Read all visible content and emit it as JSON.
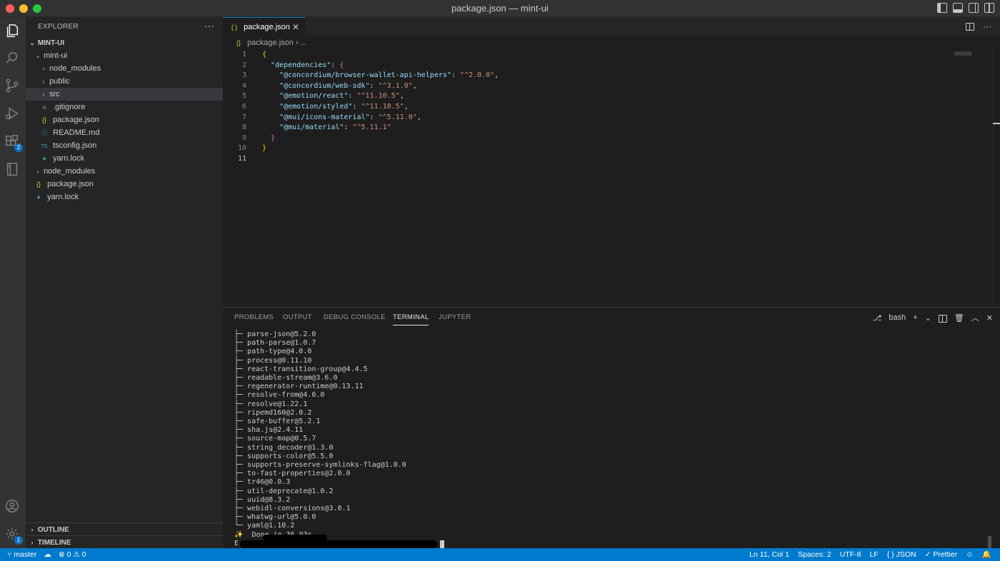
{
  "window": {
    "title": "package.json — mint-ui",
    "layout_icons": [
      "toggle-primary-sidebar-icon",
      "toggle-panel-icon",
      "toggle-secondary-sidebar-icon",
      "customize-layout-icon"
    ]
  },
  "activity_bar": {
    "items": [
      {
        "name": "explorer-icon",
        "active": true
      },
      {
        "name": "search-icon"
      },
      {
        "name": "source-control-icon"
      },
      {
        "name": "run-debug-icon"
      },
      {
        "name": "extensions-icon",
        "badge": "2"
      },
      {
        "name": "notebook-icon"
      }
    ],
    "accounts": "accounts-icon",
    "manage_badge": "1"
  },
  "sidebar": {
    "header": "EXPLORER",
    "more": "···",
    "root": "MINT-UI",
    "tree": [
      {
        "label": "mint-ui",
        "kind": "folder-open",
        "depth": 1
      },
      {
        "label": "node_modules",
        "kind": "folder",
        "depth": 2
      },
      {
        "label": "public",
        "kind": "folder",
        "depth": 2
      },
      {
        "label": "src",
        "kind": "folder",
        "depth": 2,
        "selected": true
      },
      {
        "label": ".gitignore",
        "kind": "git",
        "depth": 2
      },
      {
        "label": "package.json",
        "kind": "json",
        "depth": 2
      },
      {
        "label": "README.md",
        "kind": "info",
        "depth": 2
      },
      {
        "label": "tsconfig.json",
        "kind": "ts",
        "depth": 2
      },
      {
        "label": "yarn.lock",
        "kind": "yarn",
        "depth": 2
      },
      {
        "label": "node_modules",
        "kind": "folder",
        "depth": 1
      },
      {
        "label": "package.json",
        "kind": "json",
        "depth": 1
      },
      {
        "label": "yarn.lock",
        "kind": "yarn",
        "depth": 1
      }
    ],
    "outline": "OUTLINE",
    "timeline": "TIMELINE"
  },
  "tabs": [
    {
      "label": "package.json",
      "icon": "{ }",
      "active": true
    }
  ],
  "breadcrumb": {
    "file": "package.json",
    "rest": "..."
  },
  "editor": {
    "current_line": 11,
    "lines": [
      {
        "n": "1",
        "parts": [
          [
            "b1",
            "{"
          ]
        ]
      },
      {
        "n": "2",
        "parts": [
          [
            "",
            "  "
          ],
          [
            "k",
            "\"dependencies\""
          ],
          [
            "",
            ": "
          ],
          [
            "b2",
            "{"
          ]
        ]
      },
      {
        "n": "3",
        "parts": [
          [
            "",
            "    "
          ],
          [
            "k",
            "\"@concordium/browser-wallet-api-helpers\""
          ],
          [
            "",
            ": "
          ],
          [
            "s",
            "\"^2.0.0\""
          ],
          [
            "",
            ","
          ]
        ]
      },
      {
        "n": "4",
        "parts": [
          [
            "",
            "    "
          ],
          [
            "k",
            "\"@concordium/web-sdk\""
          ],
          [
            "",
            ": "
          ],
          [
            "s",
            "\"^3.1.0\""
          ],
          [
            "",
            ","
          ]
        ]
      },
      {
        "n": "5",
        "parts": [
          [
            "",
            "    "
          ],
          [
            "k",
            "\"@emotion/react\""
          ],
          [
            "",
            ": "
          ],
          [
            "s",
            "\"^11.10.5\""
          ],
          [
            "",
            ","
          ]
        ]
      },
      {
        "n": "6",
        "parts": [
          [
            "",
            "    "
          ],
          [
            "k",
            "\"@emotion/styled\""
          ],
          [
            "",
            ": "
          ],
          [
            "s",
            "\"^11.10.5\""
          ],
          [
            "",
            ","
          ]
        ]
      },
      {
        "n": "7",
        "parts": [
          [
            "",
            "    "
          ],
          [
            "k",
            "\"@mui/icons-material\""
          ],
          [
            "",
            ": "
          ],
          [
            "s",
            "\"^5.11.0\""
          ],
          [
            "",
            ","
          ]
        ]
      },
      {
        "n": "8",
        "parts": [
          [
            "",
            "    "
          ],
          [
            "k",
            "\"@mui/material\""
          ],
          [
            "",
            ": "
          ],
          [
            "s",
            "\"^5.11.1\""
          ]
        ]
      },
      {
        "n": "9",
        "parts": [
          [
            "",
            "  "
          ],
          [
            "b2",
            "}"
          ]
        ]
      },
      {
        "n": "10",
        "parts": [
          [
            "b1",
            "}"
          ]
        ]
      },
      {
        "n": "11",
        "parts": []
      }
    ]
  },
  "panel": {
    "tabs": [
      "PROBLEMS",
      "OUTPUT",
      "DEBUG CONSOLE",
      "TERMINAL",
      "JUPYTER"
    ],
    "active_tab": "TERMINAL",
    "shell": "bash",
    "terminal_lines": [
      "├─ parse-json@5.2.0",
      "├─ path-parse@1.0.7",
      "├─ path-type@4.0.0",
      "├─ process@0.11.10",
      "├─ react-transition-group@4.4.5",
      "├─ readable-stream@3.6.0",
      "├─ regenerator-runtime@0.13.11",
      "├─ resolve-from@4.0.0",
      "├─ resolve@1.22.1",
      "├─ ripemd160@2.0.2",
      "├─ safe-buffer@5.2.1",
      "├─ sha.js@2.4.11",
      "├─ source-map@0.5.7",
      "├─ string_decoder@1.3.0",
      "├─ supports-color@5.5.0",
      "├─ supports-preserve-symlinks-flag@1.0.0",
      "├─ to-fast-properties@2.0.0",
      "├─ tr46@0.0.3",
      "├─ util-deprecate@1.0.2",
      "├─ uuid@8.3.2",
      "├─ webidl-conversions@3.0.1",
      "├─ whatwg-url@5.0.0",
      "└─ yaml@1.10.2",
      "✨  Done in 36.93s."
    ],
    "prompt_start": "E"
  },
  "status_bar": {
    "branch": "master",
    "errors": "0",
    "warnings": "0",
    "position": "Ln 11, Col 1",
    "spaces": "Spaces: 2",
    "encoding": "UTF-8",
    "eol": "LF",
    "language": "JSON",
    "formatter": "Prettier"
  },
  "colors": {
    "accent": "#007acc",
    "activity_bg": "#333333",
    "sidebar_bg": "#252526",
    "editor_bg": "#1e1e1e",
    "json_key": "#9cdcfe",
    "json_string": "#ce9178"
  }
}
